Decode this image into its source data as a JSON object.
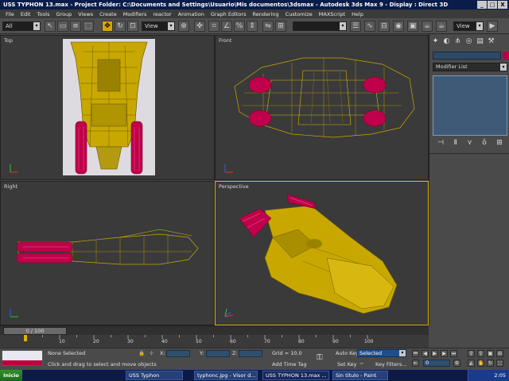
{
  "title": {
    "text": "USS TYPHON 13.max  - Project Folder: C:\\Documents and Settings\\Usuario\\Mis documentos\\3dsmax  - Autodesk 3ds Max 9  - Display : Direct 3D",
    "buttons": [
      "_",
      "□",
      "X"
    ]
  },
  "menu": [
    "File",
    "Edit",
    "Tools",
    "Group",
    "Views",
    "Create",
    "Modifiers",
    "reactor",
    "Animation",
    "Graph Editors",
    "Rendering",
    "Customize",
    "MAXScript",
    "Help"
  ],
  "toolbar": {
    "selection_filter": "All",
    "ref_coord": "View",
    "named_sets": "",
    "icons": [
      "undo-icon",
      "redo-icon",
      "link-icon",
      "unlink-icon",
      "bind-icon",
      "select-icon",
      "select-region-icon",
      "select-name-icon",
      "window-crossing-icon",
      "move-icon",
      "rotate-icon",
      "scale-icon",
      "pivot-icon",
      "select-manip-icon",
      "snap-icon",
      "angle-snap-icon",
      "percent-snap-icon",
      "spinner-snap-icon",
      "mirror-icon",
      "align-icon",
      "layer-icon",
      "curve-editor-icon",
      "schematic-icon",
      "material-editor-icon",
      "render-setup-icon",
      "render-icon",
      "quick-render-icon"
    ]
  },
  "viewports": {
    "top": "Top",
    "front": "Front",
    "right": "Right",
    "perspective": "Perspective"
  },
  "command_panel": {
    "tabs": [
      "create-tab-icon",
      "modify-tab-icon",
      "hierarchy-tab-icon",
      "motion-tab-icon",
      "display-tab-icon",
      "utilities-tab-icon"
    ],
    "object_name": "",
    "object_color": "#b5004a",
    "modifier_list": "Modifier List",
    "stack_icons": [
      "pin-stack-icon",
      "show-end-result-icon",
      "make-unique-icon",
      "remove-modifier-icon",
      "configure-sets-icon"
    ]
  },
  "time_slider": {
    "label": "0 / 100",
    "value": 0,
    "max": 100
  },
  "trackbar": {
    "ticks": [
      "10",
      "20",
      "30",
      "40",
      "50",
      "60",
      "70",
      "80",
      "90",
      "100"
    ]
  },
  "status": {
    "selection": "None Selected",
    "prompt": "Click and drag to select and move objects",
    "x_label": "X:",
    "y_label": "Y:",
    "z_label": "Z:",
    "grid": "Grid = 10,0",
    "add_time_tag": "Add Time Tag",
    "auto_key": "Auto Key",
    "set_key": "Set Key",
    "selected": "Selected",
    "key_filters": "Key Filters...",
    "frame": "0"
  },
  "taskbar": {
    "start": "Inicio",
    "items": [
      "USS Typhon",
      "typhonc.jpg - Visor d...",
      "USS TYPHON 13.max ...",
      "Sin título - Paint"
    ],
    "clock": "2:05"
  },
  "colors": {
    "accent": "#d9b400",
    "model": "#c8a800",
    "nacelle": "#c0004a"
  }
}
